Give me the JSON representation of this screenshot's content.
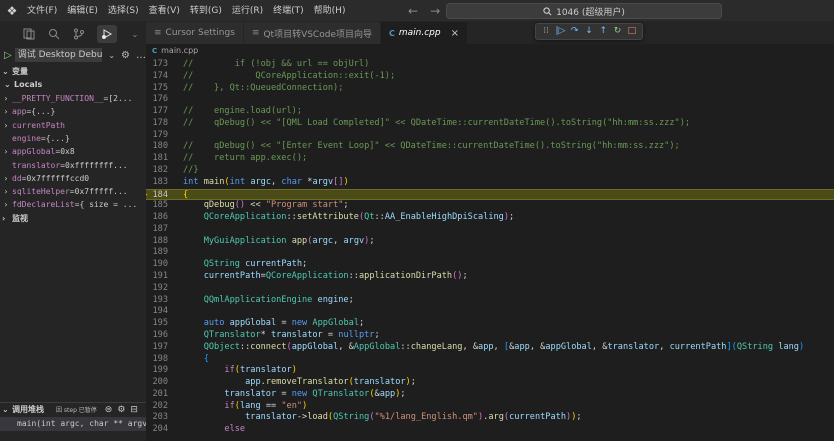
{
  "app": {
    "logo_glyph": "❖"
  },
  "menu": [
    "文件(F)",
    "编辑(E)",
    "选择(S)",
    "查看(V)",
    "转到(G)",
    "运行(R)",
    "终端(T)",
    "帮助(H)"
  ],
  "nav": {
    "back": "←",
    "forward": "→"
  },
  "search": {
    "text": "1046 (超级用户)"
  },
  "debug_toolbar": {
    "grip": "⁞⁞",
    "continue": "|▷",
    "step_over": "↷",
    "step_into": "↓",
    "step_out": "↑",
    "restart": "↻",
    "stop": "□"
  },
  "sidebar": {
    "run_config": "调试 Desktop Debu",
    "variables_title": "变量",
    "locals_title": "Locals",
    "variables": [
      {
        "chev": "›",
        "name": "__PRETTY_FUNCTION__",
        "eq": " = ",
        "value": "[2..."
      },
      {
        "chev": "›",
        "name": "app",
        "eq": " = ",
        "value": "{...}"
      },
      {
        "chev": "›",
        "name": "currentPath",
        "eq": "",
        "value": ""
      },
      {
        "chev": "",
        "name": "engine",
        "eq": " = ",
        "value": "{...}"
      },
      {
        "chev": "›",
        "name": "appGlobal",
        "eq": " = ",
        "value": "0x8"
      },
      {
        "chev": "",
        "name": "translator",
        "eq": " = ",
        "value": "0xffffffff..."
      },
      {
        "chev": "›",
        "name": "dd",
        "eq": " = ",
        "value": "0x7ffffffccd0"
      },
      {
        "chev": "›",
        "name": "sqliteHelper",
        "eq": " = ",
        "value": "0x7fffff..."
      },
      {
        "chev": "›",
        "name": "fdDeclareList",
        "eq": " = ",
        "value": "{ size = ..."
      }
    ],
    "watch_title": "监视",
    "callstack_title": "调用堆栈",
    "callstack_status": "因 step 已暂停",
    "callstack_frame": "main(int argc, char ** argv"
  },
  "tabs": [
    {
      "icon": "≡",
      "label": "Cursor Settings",
      "active": false
    },
    {
      "icon": "≡",
      "label": "Qt项目转VSCode项目向导",
      "active": false
    },
    {
      "icon": "C",
      "label": "main.cpp",
      "active": true,
      "close": "×"
    }
  ],
  "breadcrumb": {
    "icon": "C",
    "file": "main.cpp"
  },
  "editor": {
    "current_line": 184,
    "lines": [
      {
        "n": 173,
        "html": "<span class='c-comment'>//        if (!obj &amp;&amp; url == objUrl)</span>"
      },
      {
        "n": 174,
        "html": "<span class='c-comment'>//            QCoreApplication::exit(-1);</span>"
      },
      {
        "n": 175,
        "html": "<span class='c-comment'>//    }, Qt::QueuedConnection);</span>"
      },
      {
        "n": 176,
        "html": ""
      },
      {
        "n": 177,
        "html": "<span class='c-comment'>//    engine.load(url);</span>"
      },
      {
        "n": 178,
        "html": "<span class='c-comment'>//    qDebug() &lt;&lt; \"[QML Load Completed]\" &lt;&lt; QDateTime::currentDateTime().toString(\"hh:mm:ss.zzz\");</span>"
      },
      {
        "n": 179,
        "html": ""
      },
      {
        "n": 180,
        "html": "<span class='c-comment'>//    qDebug() &lt;&lt; \"[Enter Event Loop]\" &lt;&lt; QDateTime::currentDateTime().toString(\"hh:mm:ss.zzz\");</span>"
      },
      {
        "n": 181,
        "html": "<span class='c-comment'>//    return app.exec();</span>"
      },
      {
        "n": 182,
        "html": "<span class='c-comment'>//}</span>"
      },
      {
        "n": 183,
        "html": "<span class='c-kw'>int</span> <span class='c-fn'>main</span><span class='c-brk'>(</span><span class='c-kw'>int</span> <span class='c-var'>argc</span>, <span class='c-kw'>char</span> *<span class='c-var'>argv</span><span class='c-brk2'>[]</span><span class='c-brk'>)</span>"
      },
      {
        "n": 184,
        "html": "<span class='c-brk'>{</span>"
      },
      {
        "n": 185,
        "html": "    <span class='c-fn'>qDebug</span><span class='c-brk2'>()</span> &lt;&lt; <span class='c-str'>\"Program start\"</span>;"
      },
      {
        "n": 186,
        "html": "    <span class='c-type'>QCoreApplication</span>::<span class='c-fn'>setAttribute</span><span class='c-brk2'>(</span><span class='c-type'>Qt</span>::<span class='c-var'>AA_EnableHighDpiScaling</span><span class='c-brk2'>)</span>;"
      },
      {
        "n": 187,
        "html": ""
      },
      {
        "n": 188,
        "html": "    <span class='c-type'>MyGuiApplication</span> <span class='c-fn'>app</span><span class='c-brk2'>(</span><span class='c-var'>argc</span>, <span class='c-var'>argv</span><span class='c-brk2'>)</span>;"
      },
      {
        "n": 189,
        "html": ""
      },
      {
        "n": 190,
        "html": "    <span class='c-type'>QString</span> <span class='c-var'>currentPath</span>;"
      },
      {
        "n": 191,
        "html": "    <span class='c-var'>currentPath</span>=<span class='c-type'>QCoreApplication</span>::<span class='c-fn'>applicationDirPath</span><span class='c-brk2'>()</span>;"
      },
      {
        "n": 192,
        "html": ""
      },
      {
        "n": 193,
        "html": "    <span class='c-type'>QQmlApplicationEngine</span> <span class='c-var'>engine</span>;"
      },
      {
        "n": 194,
        "html": ""
      },
      {
        "n": 195,
        "html": "    <span class='c-kw'>auto</span> <span class='c-var'>appGlobal</span> = <span class='c-kw'>new</span> <span class='c-type'>AppGlobal</span>;"
      },
      {
        "n": 196,
        "html": "    <span class='c-type'>QTranslator</span>* <span class='c-var'>translator</span> = <span class='c-kw'>nullptr</span>;"
      },
      {
        "n": 197,
        "html": "    <span class='c-type'>QObject</span>::<span class='c-fn'>connect</span><span class='c-brk2'>(</span><span class='c-var'>appGlobal</span>, &amp;<span class='c-type'>AppGlobal</span>::<span class='c-fn'>changeLang</span>, &amp;<span class='c-var'>app</span>, <span class='c-brk3'>[</span>&amp;<span class='c-var'>app</span>, &amp;<span class='c-var'>appGlobal</span>, &amp;<span class='c-var'>translator</span>, <span class='c-var'>currentPath</span><span class='c-brk3'>]</span><span class='c-brk3'>(</span><span class='c-type'>QString</span> <span class='c-var'>lang</span><span class='c-brk3'>)</span>"
      },
      {
        "n": 198,
        "html": "    <span class='c-brk3'>{</span>"
      },
      {
        "n": 199,
        "html": "        <span class='c-ctrl'>if</span><span class='c-brk'>(</span><span class='c-var'>translator</span><span class='c-brk'>)</span>"
      },
      {
        "n": 200,
        "html": "            <span class='c-var'>app</span>.<span class='c-fn'>removeTranslator</span><span class='c-brk'>(</span><span class='c-var'>translator</span><span class='c-brk'>)</span>;"
      },
      {
        "n": 201,
        "html": "        <span class='c-var'>translator</span> = <span class='c-kw'>new</span> <span class='c-type'>QTranslator</span><span class='c-brk'>(</span>&amp;<span class='c-var'>app</span><span class='c-brk'>)</span>;"
      },
      {
        "n": 202,
        "html": "        <span class='c-ctrl'>if</span><span class='c-brk'>(</span><span class='c-var'>lang</span> == <span class='c-str'>\"en\"</span><span class='c-brk'>)</span>"
      },
      {
        "n": 203,
        "html": "            <span class='c-var'>translator</span>-&gt;<span class='c-fn'>load</span><span class='c-brk'>(</span><span class='c-type'>QString</span><span class='c-brk2'>(</span><span class='c-str'>\"%1/lang_English.qm\"</span><span class='c-brk2'>)</span>.<span class='c-fn'>arg</span><span class='c-brk2'>(</span><span class='c-var'>currentPath</span><span class='c-brk2'>)</span><span class='c-brk'>)</span>;"
      },
      {
        "n": 204,
        "html": "        <span class='c-ctrl'>else</span>"
      }
    ]
  },
  "colors": {
    "current_line_bg": "#4b4b18",
    "accent": "#75beff",
    "debug_arrow": "#ffcc00"
  }
}
